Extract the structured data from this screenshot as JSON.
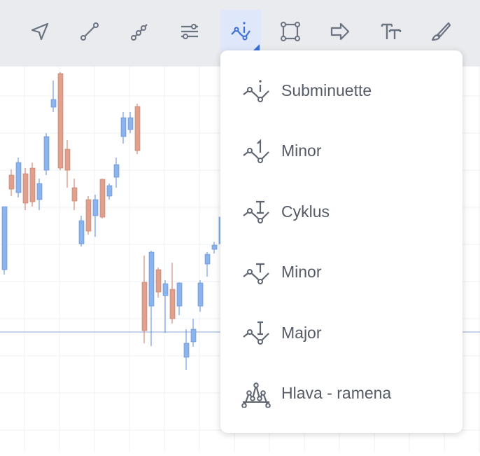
{
  "toolbar": {
    "tools": [
      {
        "icon": "cursor-arrow-icon"
      },
      {
        "icon": "trend-line-icon"
      },
      {
        "icon": "multi-point-line-icon"
      },
      {
        "icon": "settings-sliders-icon"
      },
      {
        "icon": "elliott-wave-icon",
        "active": true
      },
      {
        "icon": "rectangle-icon"
      },
      {
        "icon": "arrow-right-icon"
      },
      {
        "icon": "text-icon"
      },
      {
        "icon": "brush-icon"
      }
    ],
    "active_color": "#3d6fd8"
  },
  "menu": {
    "items": [
      {
        "label": "Subminuette",
        "icon": "wave-subminuette-icon"
      },
      {
        "label": "Minor",
        "icon": "wave-minor-icon"
      },
      {
        "label": "Cyklus",
        "icon": "wave-cycle-icon"
      },
      {
        "label": "Minor",
        "icon": "wave-minor-t-icon"
      },
      {
        "label": "Major",
        "icon": "wave-major-icon"
      },
      {
        "label": "Hlava - ramena",
        "icon": "head-shoulders-icon"
      }
    ]
  },
  "chart_data": {
    "type": "candlestick",
    "up_color": "#8ab4f0",
    "down_color": "#e2a08c",
    "candles": [
      {
        "o": 295,
        "h": 305,
        "l": 392,
        "c": 385,
        "up": true
      },
      {
        "o": 250,
        "h": 242,
        "l": 280,
        "c": 270,
        "up": false
      },
      {
        "o": 232,
        "h": 225,
        "l": 282,
        "c": 275,
        "up": true
      },
      {
        "o": 248,
        "h": 240,
        "l": 300,
        "c": 290,
        "up": false
      },
      {
        "o": 240,
        "h": 232,
        "l": 295,
        "c": 288,
        "up": false
      },
      {
        "o": 262,
        "h": 255,
        "l": 300,
        "c": 285,
        "up": true
      },
      {
        "o": 195,
        "h": 190,
        "l": 250,
        "c": 243,
        "up": true
      },
      {
        "o": 142,
        "h": 115,
        "l": 160,
        "c": 153,
        "up": true
      },
      {
        "o": 105,
        "h": 103,
        "l": 243,
        "c": 240,
        "up": false
      },
      {
        "o": 213,
        "h": 200,
        "l": 268,
        "c": 243,
        "up": false
      },
      {
        "o": 268,
        "h": 255,
        "l": 300,
        "c": 287,
        "up": false
      },
      {
        "o": 315,
        "h": 308,
        "l": 352,
        "c": 348,
        "up": true
      },
      {
        "o": 285,
        "h": 280,
        "l": 335,
        "c": 330,
        "up": false
      },
      {
        "o": 285,
        "h": 278,
        "l": 338,
        "c": 308,
        "up": true
      },
      {
        "o": 256,
        "h": 255,
        "l": 312,
        "c": 310,
        "up": false
      },
      {
        "o": 265,
        "h": 262,
        "l": 285,
        "c": 280,
        "up": true
      },
      {
        "o": 235,
        "h": 225,
        "l": 268,
        "c": 253,
        "up": true
      },
      {
        "o": 168,
        "h": 160,
        "l": 205,
        "c": 195,
        "up": true
      },
      {
        "o": 168,
        "h": 160,
        "l": 190,
        "c": 185,
        "up": true
      },
      {
        "o": 152,
        "h": 148,
        "l": 220,
        "c": 215,
        "up": false
      },
      {
        "o": 403,
        "h": 365,
        "l": 490,
        "c": 472,
        "up": false
      },
      {
        "o": 360,
        "h": 358,
        "l": 494,
        "c": 437,
        "up": true
      },
      {
        "o": 385,
        "h": 382,
        "l": 425,
        "c": 417,
        "up": false
      },
      {
        "o": 405,
        "h": 400,
        "l": 475,
        "c": 422,
        "up": true
      },
      {
        "o": 413,
        "h": 375,
        "l": 462,
        "c": 455,
        "up": false
      },
      {
        "o": 404,
        "h": 403,
        "l": 450,
        "c": 437,
        "up": true
      },
      {
        "o": 490,
        "h": 470,
        "l": 528,
        "c": 510,
        "up": true
      },
      {
        "o": 470,
        "h": 455,
        "l": 495,
        "c": 488,
        "up": true
      },
      {
        "o": 404,
        "h": 400,
        "l": 445,
        "c": 437,
        "up": true
      },
      {
        "o": 363,
        "h": 360,
        "l": 395,
        "c": 377,
        "up": true
      },
      {
        "o": 350,
        "h": 345,
        "l": 362,
        "c": 356,
        "up": true
      },
      {
        "o": 310,
        "h": 300,
        "l": 350,
        "c": 348,
        "up": true
      }
    ],
    "hline": 474
  }
}
